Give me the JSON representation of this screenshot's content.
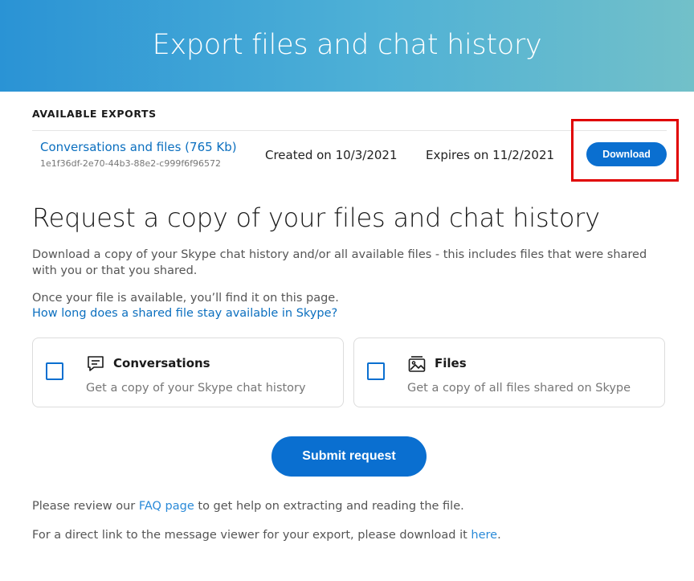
{
  "header": {
    "title": "Export files and chat history"
  },
  "available_exports": {
    "label": "AVAILABLE EXPORTS",
    "items": [
      {
        "name": "Conversations and files (765 Kb)",
        "id": "1e1f36df-2e70-44b3-88e2-c999f6f96572",
        "created": "Created on 10/3/2021",
        "expires": "Expires on 11/2/2021",
        "action_label": "Download"
      }
    ]
  },
  "request": {
    "heading": "Request a copy of your files and chat history",
    "description": "Download a copy of your Skype chat history and/or all available files - this includes files that were shared with you or that you shared.",
    "note": "Once your file is available, you’ll find it on this page.",
    "faq_link": "How long does a shared file stay available in Skype?",
    "options": [
      {
        "title": "Conversations",
        "description": "Get a copy of your Skype chat history",
        "icon": "chat-bubble-icon",
        "checked": false
      },
      {
        "title": "Files",
        "description": "Get a copy of all files shared on Skype",
        "icon": "image-files-icon",
        "checked": false
      }
    ],
    "submit_label": "Submit request"
  },
  "footer": {
    "line1_prefix": "Please review our ",
    "line1_link": "FAQ page",
    "line1_suffix": " to get help on extracting and reading the file.",
    "line2_prefix": "For a direct link to the message viewer for your export, please download it ",
    "line2_link": "here",
    "line2_suffix": "."
  },
  "colors": {
    "accent": "#0a6fd0",
    "link": "#0b6fbf",
    "highlight": "#e00000"
  }
}
